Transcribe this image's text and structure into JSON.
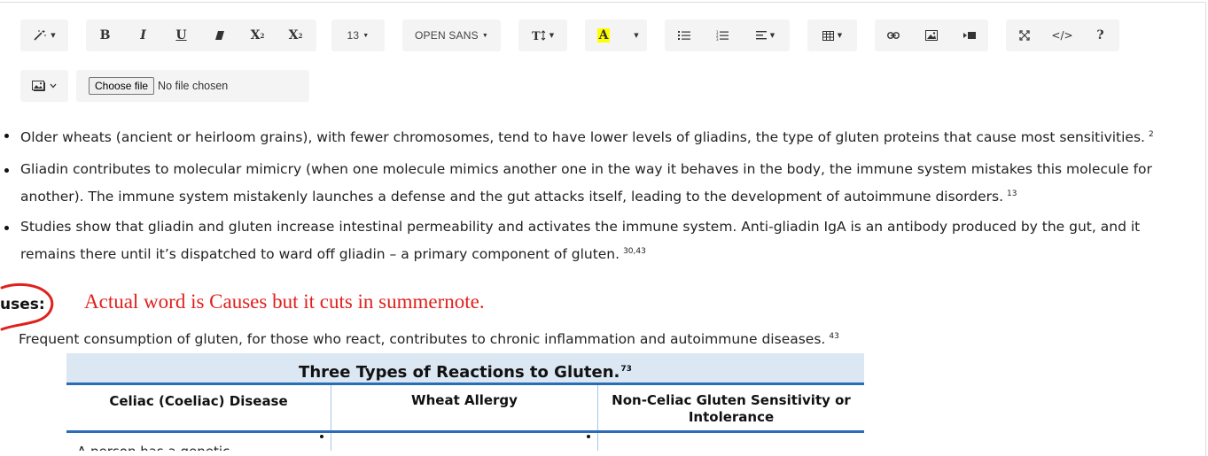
{
  "toolbar": {
    "row1": {
      "font_size": "13",
      "font_name": "OPEN SANS",
      "bold": "B",
      "italic": "I",
      "underline": "U",
      "superscript": "X",
      "subscript": "X",
      "highlight": "A",
      "help": "?",
      "code": "</>"
    },
    "row2": {
      "choose_file": "Choose file",
      "no_file": "No file chosen"
    }
  },
  "content": {
    "bullets": [
      {
        "text": "Older wheats (ancient or heirloom grains), with fewer chromosomes, tend to have lower levels of gliadins, the type of gluten proteins that cause most sensitivities.",
        "cite": "2"
      },
      {
        "text": "Gliadin contributes to molecular mimicry (when one molecule mimics another one in the way it behaves in the body, the immune system mistakes this molecule for another). The immune system mistakenly launches a defense and the gut attacks itself, leading to the development of autoimmune disorders.",
        "cite": "13"
      },
      {
        "text": "Studies show that gliadin and gluten increase intestinal permeability and activates the immune system. Anti-gliadin IgA is an antibody produced by the gut, and it remains there until it’s dispatched to ward off gliadin – a primary component of gluten.",
        "cite": "30,43"
      }
    ],
    "heading": "uses:",
    "annotation": "Actual word is Causes but it cuts in summernote.",
    "paragraph": "Frequent consumption of gluten, for those who react, contributes to chronic inflammation and autoimmune diseases.",
    "paragraph_cite": "43",
    "table": {
      "title": "Three Types of Reactions to Gluten.",
      "title_cite": "73",
      "headers": [
        "Celiac (Coeliac) Disease",
        "Wheat Allergy",
        "Non-Celiac Gluten Sensitivity or Intolerance"
      ],
      "first_cell": "A person has a genetic"
    }
  },
  "colors": {
    "annotation": "#e0201c",
    "table_border": "#2a6cb5",
    "table_header_bg": "#dbe7f3",
    "highlight": "#ffff00"
  }
}
